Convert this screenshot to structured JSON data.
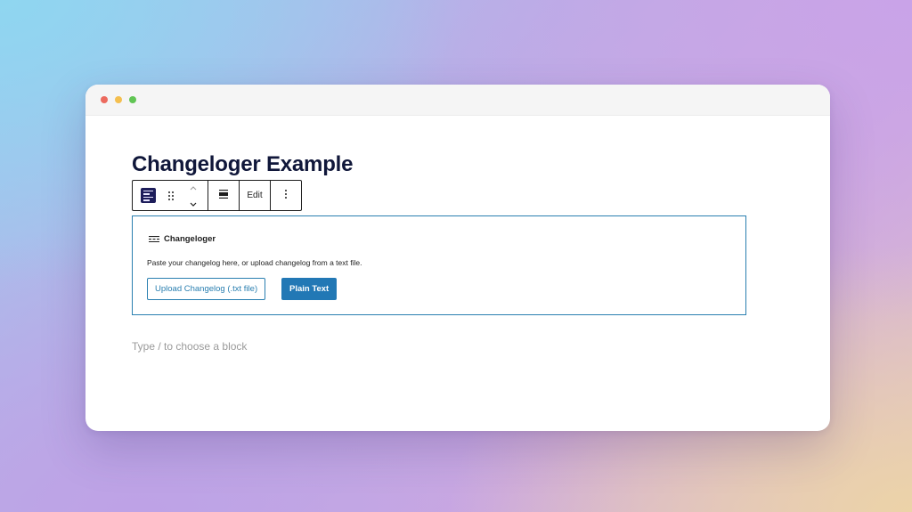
{
  "window": {
    "controls": [
      "close",
      "minimize",
      "maximize"
    ]
  },
  "editor": {
    "title": "Changeloger Example",
    "toolbar": {
      "block_icon": "changeloger-block-icon",
      "drag_icon": "drag-handle-icon",
      "move_up_icon": "chevron-up-icon",
      "move_down_icon": "chevron-down-icon",
      "align_icon": "align-center-icon",
      "edit_label": "Edit",
      "more_icon": "more-vertical-icon"
    },
    "block": {
      "icon": "changelog-lines-icon",
      "title": "Changeloger",
      "instructions": "Paste your changelog here, or upload changelog from a text file.",
      "upload_label": "Upload Changelog (.txt file)",
      "plain_text_label": "Plain Text"
    },
    "appender_placeholder": "Type / to choose a block"
  },
  "colors": {
    "accent": "#2a7fb0",
    "primary_button": "#2278b5",
    "title": "#10173a"
  }
}
